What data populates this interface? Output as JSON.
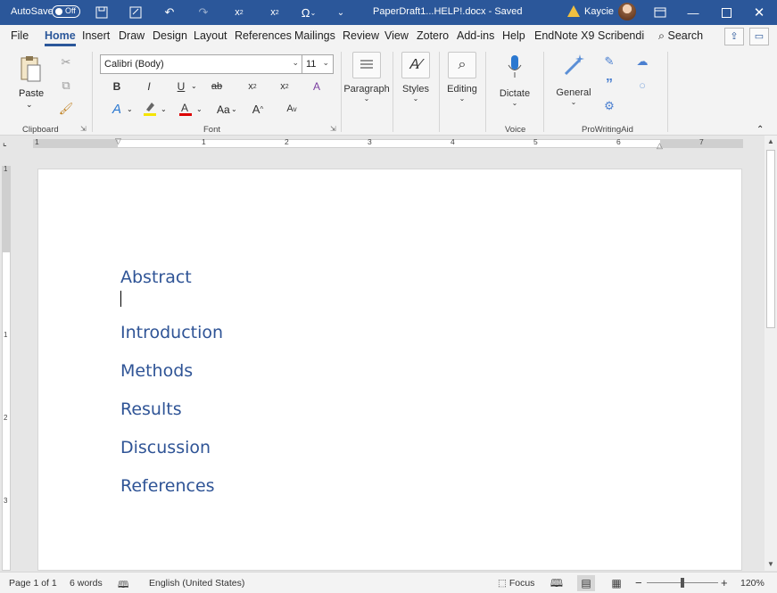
{
  "titlebar": {
    "autosave_label": "AutoSave",
    "autosave_state": "Off",
    "doc_title": "PaperDraft1...HELP!.docx - Saved",
    "user_name": "Kaycie"
  },
  "menu": {
    "tabs": [
      "File",
      "Home",
      "Insert",
      "Draw",
      "Design",
      "Layout",
      "References",
      "Mailings",
      "Review",
      "View",
      "Zotero",
      "Add-ins",
      "Help",
      "EndNote X9",
      "Scribendi"
    ],
    "active_tab": "Home",
    "search_label": "Search"
  },
  "ribbon": {
    "clipboard": {
      "paste_label": "Paste",
      "group_label": "Clipboard"
    },
    "font": {
      "font_name": "Calibri (Body)",
      "font_size": "11",
      "group_label": "Font",
      "change_case": "Aa"
    },
    "paragraph_label": "Paragraph",
    "styles_label": "Styles",
    "editing_label": "Editing",
    "voice": {
      "dictate_label": "Dictate",
      "group_label": "Voice"
    },
    "prowritingaid": {
      "general_label": "General",
      "group_label": "ProWritingAid"
    }
  },
  "ruler": {
    "h_numbers": [
      "1",
      "1",
      "2",
      "3",
      "4",
      "5",
      "6",
      "7"
    ],
    "v_numbers": [
      "1",
      "1",
      "2",
      "3"
    ]
  },
  "document": {
    "headings": [
      "Abstract",
      "Introduction",
      "Methods",
      "Results",
      "Discussion",
      "References"
    ]
  },
  "statusbar": {
    "page": "Page 1 of 1",
    "words": "6 words",
    "language": "English (United States)",
    "focus": "Focus",
    "zoom": "120%"
  }
}
